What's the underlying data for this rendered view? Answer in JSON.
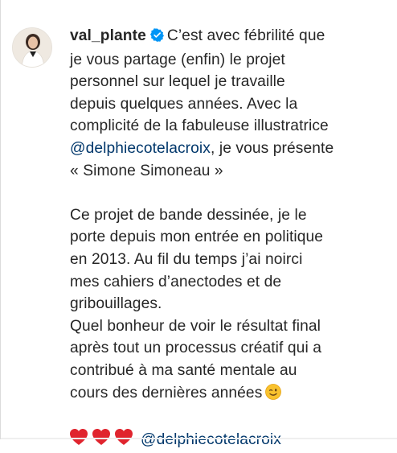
{
  "post": {
    "username": "val_plante",
    "caption_lines": [
      "C’est avec fébrilité que",
      "je vous partage (enfin) le projet",
      "personnel sur lequel je travaille",
      "depuis quelques années. Avec la",
      "complicité de la fabuleuse illustratrice"
    ],
    "mention_1": "@delphiecotelacroix",
    "after_mention_1": ", je vous présente",
    "title_line": "« Simone Simoneau »",
    "paragraph_2": [
      "Ce projet de bande dessinée, je le",
      "porte depuis mon entrée en politique",
      "en 2013. Au fil du temps j’ai noirci",
      "mes cahiers d’anectodes et de",
      "gribouillages.",
      "Quel bonheur de voir le résultat final",
      "après tout un processus créatif qui a",
      "contribué à ma santé mentale au",
      "cours des dernières années"
    ],
    "mention_2": "@delphiecotelacroix",
    "icons": {
      "verified": "verified-badge-icon",
      "emoji_wink": "winking-face-emoji",
      "hearts": "red-heart-emoji"
    },
    "colors": {
      "text": "#262626",
      "mention": "#00376b",
      "verified": "#0095f6",
      "heart": "#e0242e"
    }
  }
}
